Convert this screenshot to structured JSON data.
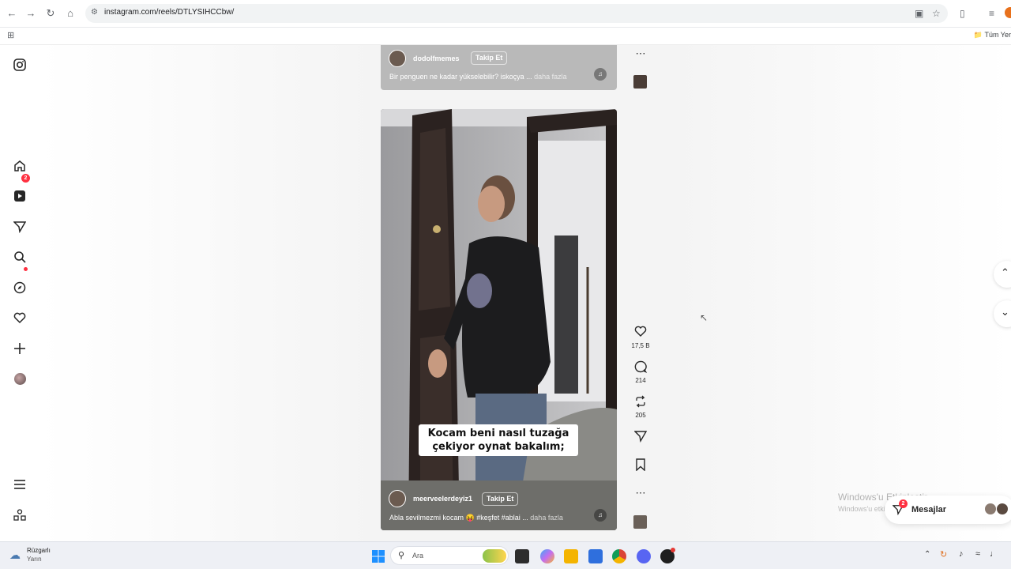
{
  "browser": {
    "url": "instagram.com/reels/DTLYSIHCCbw/",
    "bookmarks_all": "Tüm Yer"
  },
  "reels": [
    {
      "username": "dodolfmemes",
      "follow_label": "Takip Et",
      "caption": "Bir penguen ne kadar yükselebilir? iskoçya ...",
      "more": "daha fazla"
    },
    {
      "username": "meerveelerdeyiz1",
      "follow_label": "Takip Et",
      "caption": "Abla sevilmezmi kocam 😝 #keşfet #ablai ...",
      "more": "daha fazla",
      "subtitle_line1": "Kocam beni nasıl tuzağa",
      "subtitle_line2": "çekiyor oynat bakalım;",
      "likes": "17,5 B",
      "comments": "214",
      "reposts": "205"
    }
  ],
  "sidebar": {
    "notification_count": "2"
  },
  "messages": {
    "label": "Mesajlar",
    "badge": "2"
  },
  "windows_watermark": {
    "title": "Windows'u Etkinleştir",
    "subtitle": "Windows'u etkinleştirmek için Ayarlar'a gidin."
  },
  "taskbar": {
    "weather_title": "Rüzgarlı",
    "weather_sub": "Yarın",
    "search_placeholder": "Ara"
  }
}
